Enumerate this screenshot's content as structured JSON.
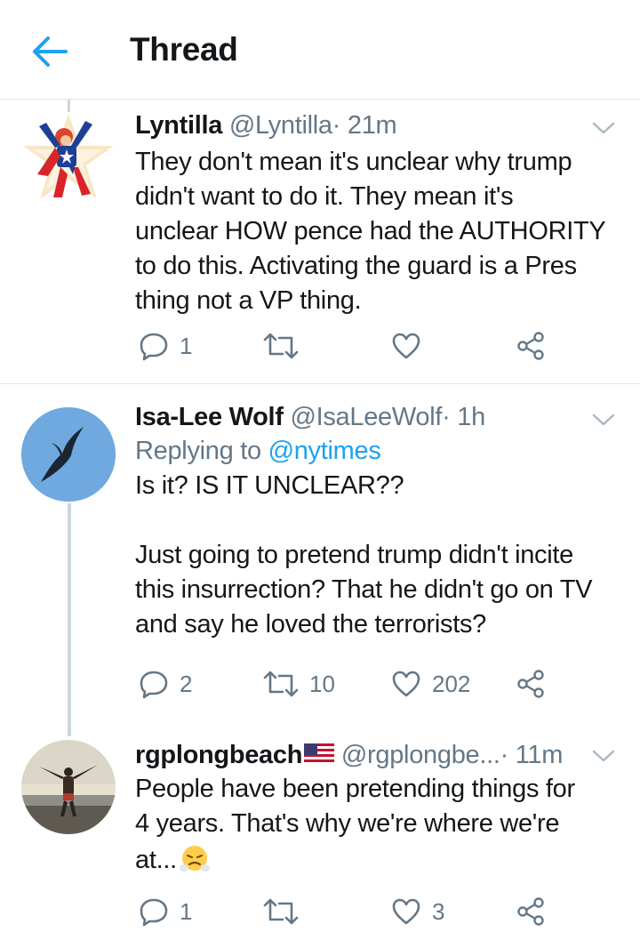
{
  "header": {
    "title": "Thread",
    "back_icon": "arrow-left-icon",
    "accent": "#1da1f2"
  },
  "tweets": [
    {
      "name": "Lyntilla",
      "handle": "@Lyntilla",
      "time": "· 21m",
      "lines": [
        "They don't mean it's unclear why trump",
        "didn't want to do it. They mean it's",
        "unclear HOW pence had the AUTHORITY",
        "to do this. Activating the guard is a Pres",
        "thing not a VP thing."
      ],
      "replies": "1",
      "retweets": "",
      "likes": ""
    },
    {
      "name": "Isa-Lee Wolf",
      "handle": "@IsaLeeWolf",
      "time": "· 1h",
      "replying_label": "Replying to",
      "replying_handle": "@nytimes",
      "lines": [
        "Is it? IS IT UNCLEAR??",
        "",
        "Just going to pretend trump didn't incite",
        "this insurrection? That he didn't go on TV",
        "and say he loved the terrorists?"
      ],
      "replies": "2",
      "retweets": "10",
      "likes": "202"
    },
    {
      "name": "rgplongbeach",
      "handle": "@rgplongbe...",
      "time": "· 11m",
      "name_emoji": "us-flag",
      "lines": [
        "People have been pretending things for",
        "4 years. That's why we're where we're",
        "at..."
      ],
      "trailing_emoji": "face-with-steam-from-nose",
      "replies": "1",
      "retweets": "",
      "likes": "3"
    }
  ],
  "colors": {
    "text": "#14171a",
    "muted": "#657786",
    "link": "#1da1f2",
    "divider": "#e1e8ed",
    "thread_line": "#ccd6dd"
  }
}
